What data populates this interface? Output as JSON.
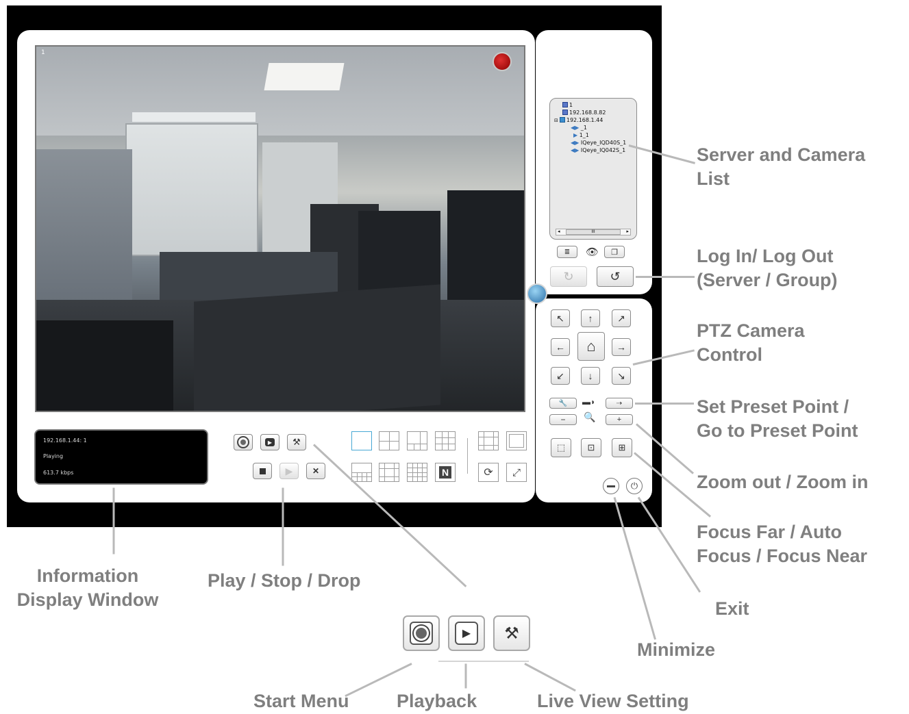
{
  "video": {
    "channel_number": "1"
  },
  "info_window": {
    "server_line": "192.168.1.44: 1",
    "status": "Playing",
    "bitrate": "613.7 kbps"
  },
  "tree": {
    "nodes": [
      "1",
      "192.168.8.82",
      "192.168.1.44",
      "_1",
      "1_1",
      "IQeye_IQD40S_1",
      "IQeye_IQ042S_1"
    ],
    "scroll_thumb": "III"
  },
  "labels": {
    "server_camera_list": [
      "Server and Camera",
      "List"
    ],
    "login_logout": [
      "Log In/ Log Out",
      "(Server / Group)"
    ],
    "ptz": [
      "PTZ Camera",
      "Control"
    ],
    "preset": [
      "Set Preset Point /",
      "Go to Preset Point"
    ],
    "zoom": "Zoom out / Zoom in",
    "focus": [
      "Focus Far / Auto",
      "Focus / Focus Near"
    ],
    "exit": "Exit",
    "minimize": "Minimize",
    "info_window": [
      "Information",
      "Display Window"
    ],
    "play_stop_drop": "Play / Stop / Drop",
    "start_menu": "Start Menu",
    "playback": "Playback",
    "live_view_setting": "Live View Setting"
  },
  "icons": {
    "start_menu": "record-circle-icon",
    "playback": "playback-icon",
    "live_view_setting": "tools-icon",
    "stop": "stop-icon",
    "play": "play-icon",
    "drop": "close-icon"
  },
  "colors": {
    "label": "#7f7f7f",
    "frame": "#000000",
    "panel": "#ffffff",
    "active_layout": "#47a8d4",
    "record": "#c41010"
  }
}
